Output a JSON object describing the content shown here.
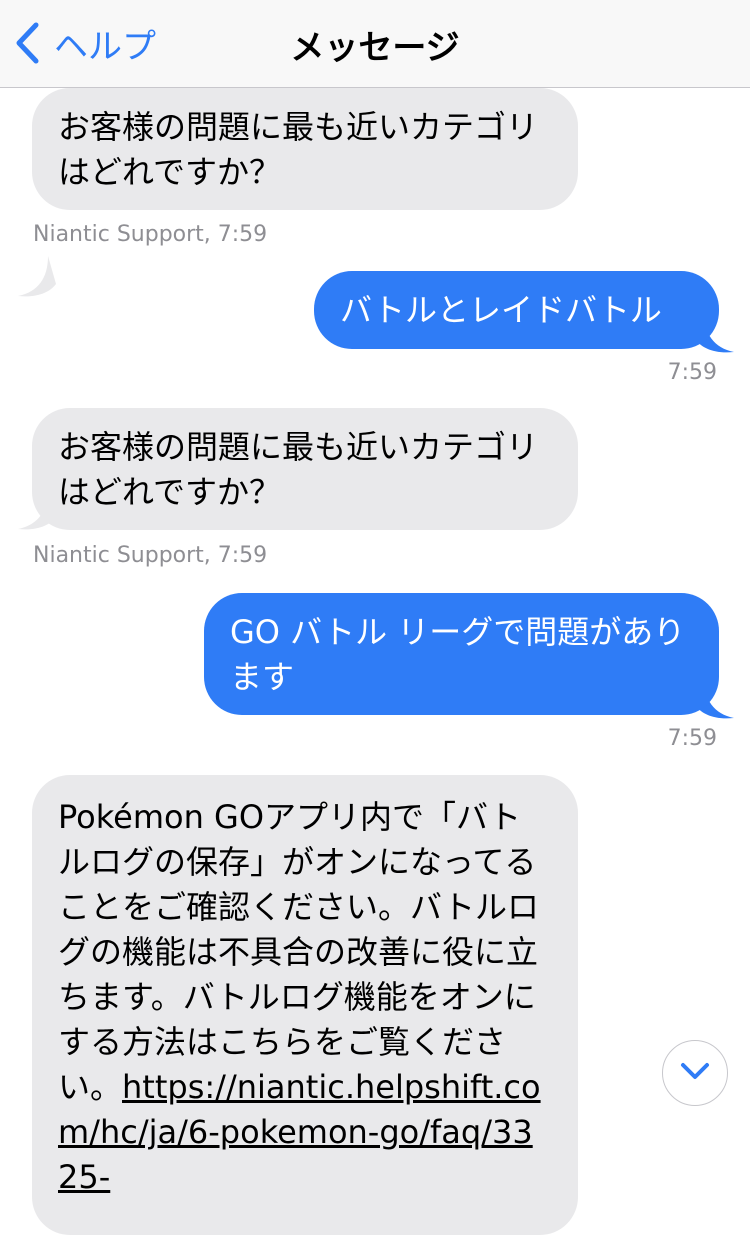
{
  "nav": {
    "back_icon": "chevron-left-icon",
    "back_label": "ヘルプ",
    "title": "メッセージ"
  },
  "messages": [
    {
      "text": "お客様の問題に最も近いカテゴリはどれですか？",
      "meta": "Niantic Support, 7:59"
    },
    {
      "text": "バトルとレイドバトル",
      "meta": "7:59"
    },
    {
      "text": "お客様の問題に最も近いカテゴリはどれですか？",
      "meta": "Niantic Support, 7:59"
    },
    {
      "text": "GO バトル リーグで問題があります",
      "meta": "7:59"
    },
    {
      "text": "Pokémon GOアプリ内で「バトルログの保存」がオンになってることをご確認ください。バトルログの機能は不具合の改善に役に立ちます。バトルログ機能をオンにする方法はこちらをご覧ください。",
      "link": "https://niantic.helpshift.com/hc/ja/6-pokemon-go/faq/3325-"
    }
  ],
  "scroll_button": {
    "icon": "chevron-down-icon"
  },
  "colors": {
    "accent": "#2f7cf6",
    "incoming_bubble": "#e9e9eb",
    "meta_text": "#8e8e93"
  }
}
